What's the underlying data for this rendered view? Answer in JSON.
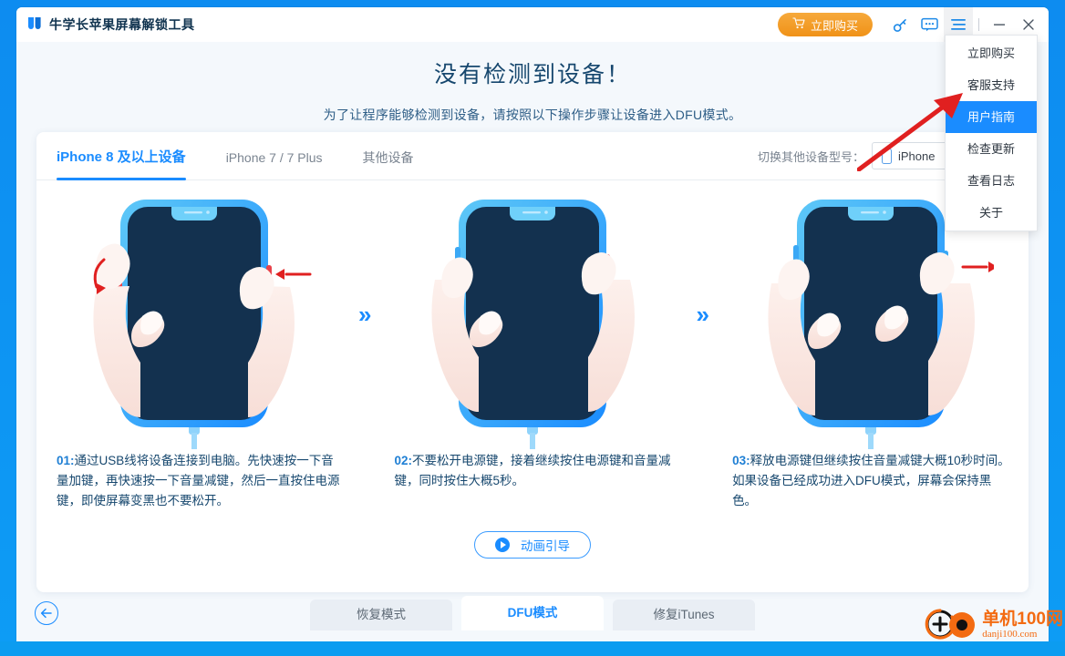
{
  "titlebar": {
    "app_title": "牛学长苹果屏幕解锁工具",
    "buy_label": "立即购买",
    "icons": {
      "cart": "cart-icon",
      "key": "key-icon",
      "chat": "chat-icon",
      "menu": "hamburger-menu-icon",
      "minimize": "minimize-icon",
      "close": "close-icon"
    }
  },
  "menu": {
    "items": [
      {
        "label": "立即购买",
        "selected": false
      },
      {
        "label": "客服支持",
        "selected": false
      },
      {
        "label": "用户指南",
        "selected": true
      },
      {
        "label": "检查更新",
        "selected": false
      },
      {
        "label": "查看日志",
        "selected": false
      },
      {
        "label": "关于",
        "selected": false
      }
    ],
    "highlight_color": "#1a8cff"
  },
  "heading": {
    "title": "没有检测到设备！",
    "subtitle": "为了让程序能够检测到设备，请按照以下操作步骤让设备进入DFU模式。"
  },
  "tabs": [
    {
      "label": "iPhone 8 及以上设备",
      "active": true
    },
    {
      "label": "iPhone 7 / 7 Plus",
      "active": false
    },
    {
      "label": "其他设备",
      "active": false
    }
  ],
  "switch_model": {
    "label": "切换其他设备型号：",
    "selected_value": "iPhone"
  },
  "steps": [
    {
      "num": "01:",
      "text": "通过USB线将设备连接到电脑。先快速按一下音量加键，再快速按一下音量减键，然后一直按住电源键，即使屏幕变黑也不要松开。"
    },
    {
      "num": "02:",
      "text": "不要松开电源键，接着继续按住电源键和音量减键，同时按住大概5秒。"
    },
    {
      "num": "03:",
      "text": "释放电源键但继续按住音量减键大概10秒时间。如果设备已经成功进入DFU模式，屏幕会保持黑色。"
    }
  ],
  "separator_glyph": "»",
  "guide_button": {
    "label": "动画引导",
    "icon": "play-icon"
  },
  "bottom": {
    "back_icon": "back-arrow-icon",
    "mode_tabs": [
      {
        "label": "恢复模式",
        "active": false
      },
      {
        "label": "DFU模式",
        "active": true
      },
      {
        "label": "修复iTunes",
        "active": false
      }
    ]
  },
  "watermark": {
    "main": "单机100网",
    "sub": "danji100.com"
  },
  "colors": {
    "accent_blue": "#1a8cff",
    "brand_orange": "#f09218",
    "title_navy": "#16476e",
    "annotation_red": "#e02020"
  }
}
